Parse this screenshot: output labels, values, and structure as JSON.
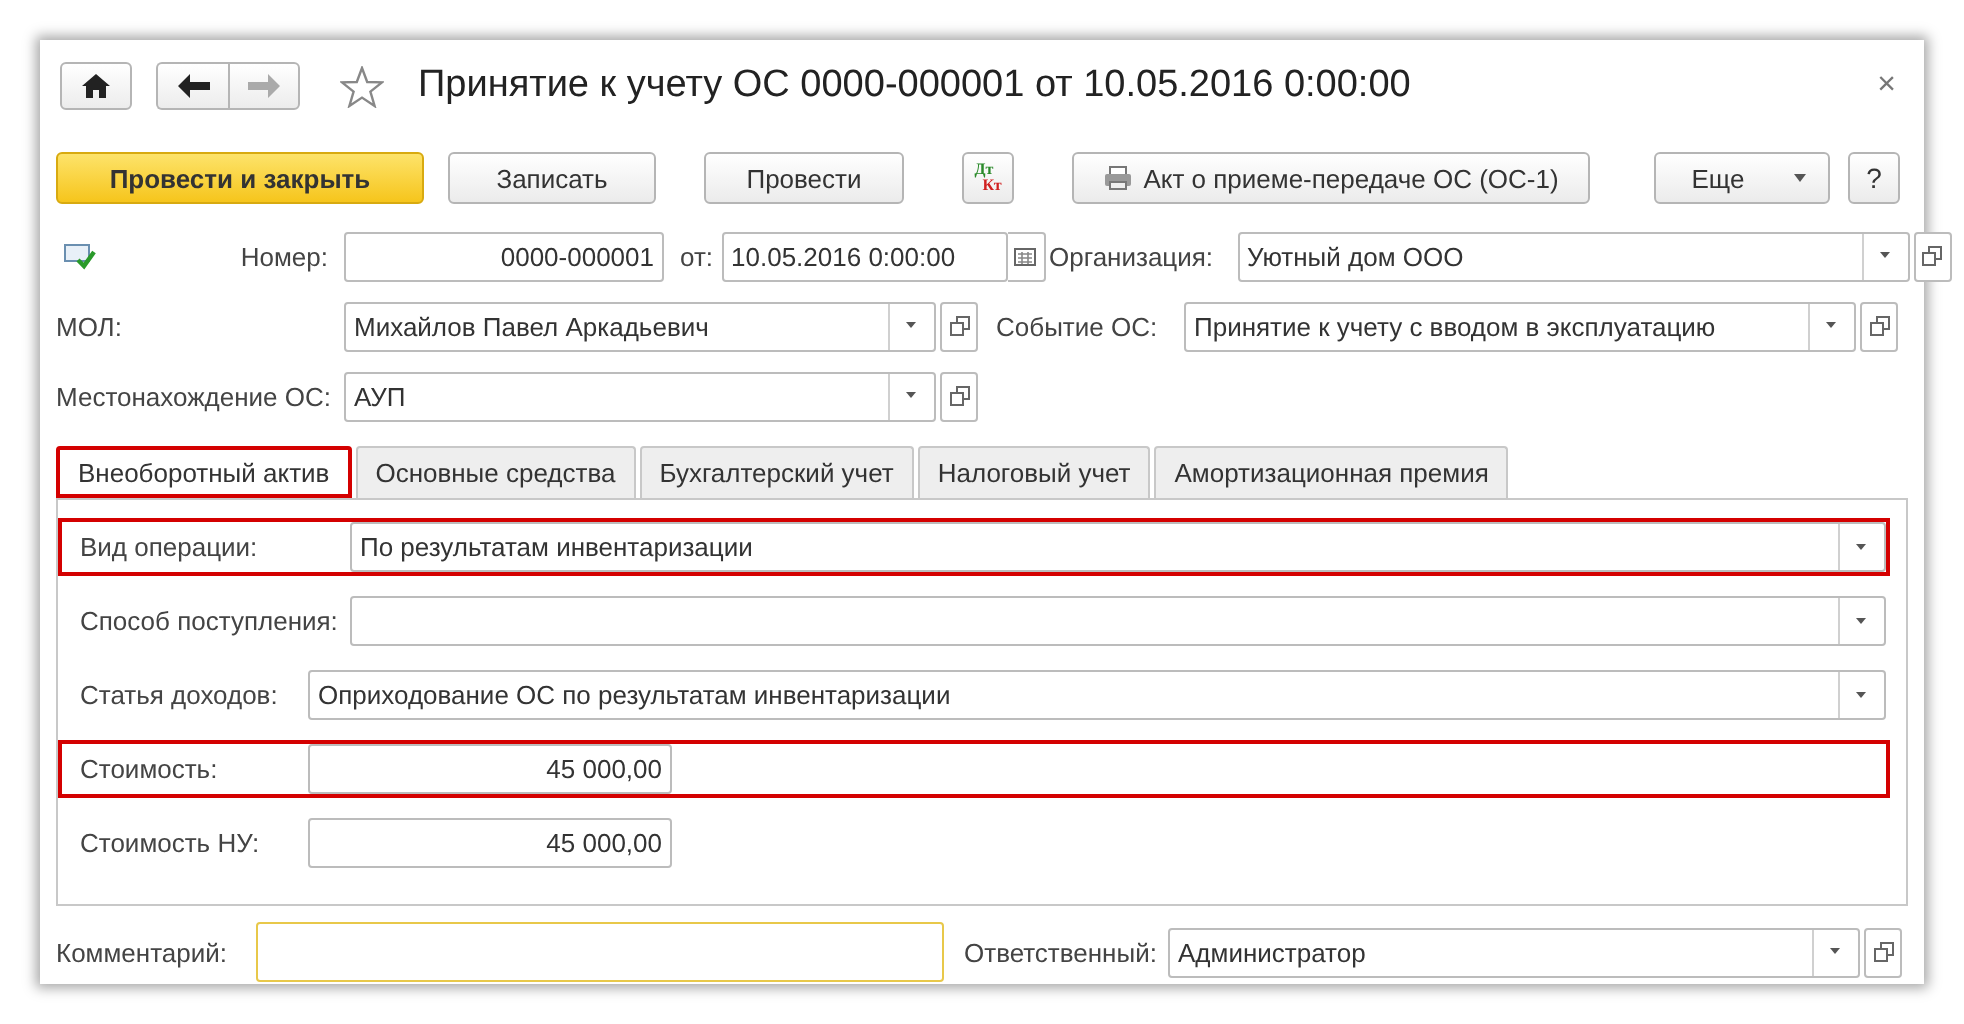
{
  "window": {
    "title": "Принятие к учету ОС 0000-000001 от 10.05.2016 0:00:00",
    "close": "×",
    "favorite": false,
    "forward_disabled": true
  },
  "toolbar": [
    {
      "kind": "primary",
      "label": "Провести и закрыть"
    },
    {
      "kind": "button",
      "label": "Записать"
    },
    {
      "kind": "button",
      "label": "Провести"
    },
    {
      "kind": "dtkt",
      "top": "Дт",
      "bottom": "Кт"
    },
    {
      "kind": "print",
      "label": "Акт о приеме-передаче ОС (ОС-1)"
    },
    {
      "kind": "menu",
      "label": "Еще"
    },
    {
      "kind": "help",
      "label": "?"
    }
  ],
  "header": {
    "posted": true,
    "number": {
      "label": "Номер:",
      "value": "0000-000001"
    },
    "date": {
      "label": "от:",
      "value": "10.05.2016  0:00:00"
    },
    "organization": {
      "label": "Организация:",
      "value": "Уютный дом ООО"
    },
    "mol": {
      "label": "МОЛ:",
      "value": "Михайлов Павел Аркадьевич"
    },
    "event": {
      "label": "Событие ОС:",
      "value": "Принятие к учету с вводом в эксплуатацию"
    },
    "location": {
      "label": "Местонахождение ОС:",
      "value": "АУП"
    }
  },
  "tabs": [
    {
      "label": "Внеоборотный актив",
      "selected": true,
      "highlighted": true
    },
    {
      "label": "Основные средства",
      "selected": false,
      "highlighted": false
    },
    {
      "label": "Бухгалтерский учет",
      "selected": false,
      "highlighted": false
    },
    {
      "label": "Налоговый учет",
      "selected": false,
      "highlighted": false
    },
    {
      "label": "Амортизационная премия",
      "selected": false,
      "highlighted": false
    }
  ],
  "tab_fields": [
    {
      "kind": "select",
      "label": "Вид операции:",
      "value": "По результатам инвентаризации",
      "highlighted": true
    },
    {
      "kind": "select",
      "label": "Способ поступления:",
      "highlighted": false
    },
    {
      "kind": "select",
      "label": "Статья доходов:",
      "value": "Оприходование ОС по результатам инвентаризации",
      "highlighted": false
    },
    {
      "kind": "number",
      "label": "Стоимость:",
      "value": "45 000,00",
      "highlighted": true
    },
    {
      "kind": "number",
      "label": "Стоимость НУ:",
      "value": "45 000,00",
      "highlighted": false
    }
  ],
  "footer": {
    "comment": {
      "label": "Комментарий:",
      "focused": true
    },
    "responsible": {
      "label": "Ответственный:",
      "value": "Администратор"
    }
  }
}
